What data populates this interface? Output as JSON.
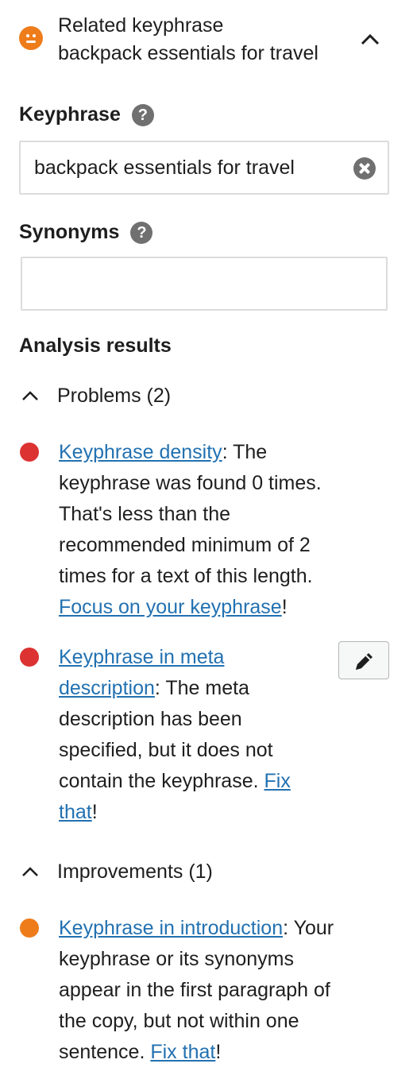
{
  "header": {
    "title": "Related keyphrase",
    "subtitle": "backpack essentials for travel",
    "status_color": "#ee7c1b"
  },
  "keyphrase": {
    "label": "Keyphrase",
    "help_icon": "?",
    "value": "backpack essentials for travel"
  },
  "synonyms": {
    "label": "Synonyms",
    "help_icon": "?",
    "value": ""
  },
  "analysis": {
    "title": "Analysis results",
    "problems": {
      "label": "Problems (2)",
      "items": [
        {
          "color": "#dc3232",
          "line1_link": "Keyphrase density",
          "line1_rest": ": The",
          "line2": "keyphrase was found 0 times.",
          "line3": "That's less than the",
          "line4": "recommended minimum of 2",
          "line5": "times for a text of this length.",
          "line6_link": "Focus on your keyphrase",
          "line6_rest": "!"
        },
        {
          "color": "#dc3232",
          "line1_link": "Keyphrase in meta",
          "line2_link": "description",
          "line2_rest": ": The meta",
          "line3": "description has been",
          "line4": "specified, but it does not",
          "line5_text": "contain the keyphrase. ",
          "line5_link": "Fix",
          "line6_link": "that",
          "line6_rest": "!"
        }
      ]
    },
    "improvements": {
      "label": "Improvements (1)",
      "items": [
        {
          "color": "#ee7c1b",
          "line1_link": "Keyphrase in introduction",
          "line1_rest": ": Your",
          "line2": "keyphrase or its synonyms",
          "line3": "appear in the first paragraph of",
          "line4": "the copy, but not within one",
          "line5_text": "sentence. ",
          "line5_link": "Fix that",
          "line5_rest": "!"
        }
      ]
    }
  }
}
